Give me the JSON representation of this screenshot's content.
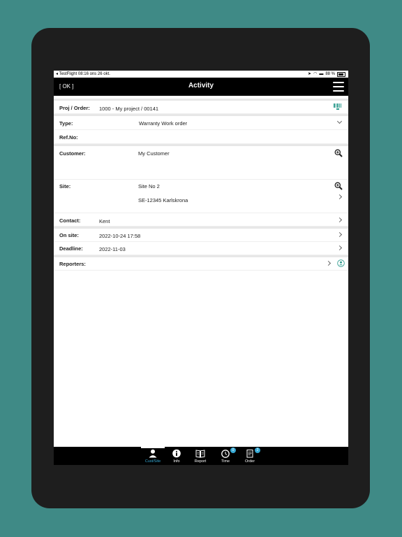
{
  "status_bar": {
    "left": "◂ TestFlight   08:16   ons 26 okt.",
    "battery": "88 %"
  },
  "navbar": {
    "ok_label": "[ OK ]",
    "title": "Activity"
  },
  "rows": {
    "proj_label": "Proj / Order:",
    "proj_value": "1000 - My project / 00141",
    "type_label": "Type:",
    "type_value": "Warranty Work order",
    "refno_label": "Ref.No:",
    "customer_label": "Customer:",
    "customer_value": "My Customer",
    "site_label": "Site:",
    "site_line1": "Site No 2",
    "site_line2": "SE-12345 Karlskrona",
    "contact_label": "Contact:",
    "contact_value": "Kent",
    "onsite_label": "On site:",
    "onsite_value": "2022-10-24 17:58",
    "deadline_label": "Deadline:",
    "deadline_value": "2022-11-03",
    "reporters_label": "Reporters:"
  },
  "tabbar": {
    "tabs": [
      {
        "label": "Cust/Site",
        "icon": "person-icon",
        "active": true
      },
      {
        "label": "Info",
        "icon": "info-icon"
      },
      {
        "label": "Report",
        "icon": "book-icon"
      },
      {
        "label": "Time",
        "icon": "clock-icon",
        "badge": "0"
      },
      {
        "label": "Order",
        "icon": "document-icon",
        "badge": "2"
      }
    ]
  },
  "colors": {
    "accent": "#36a9d4",
    "navbar": "#000000",
    "background": "#3f8a86",
    "qr_icon": "#2f9b8e"
  }
}
